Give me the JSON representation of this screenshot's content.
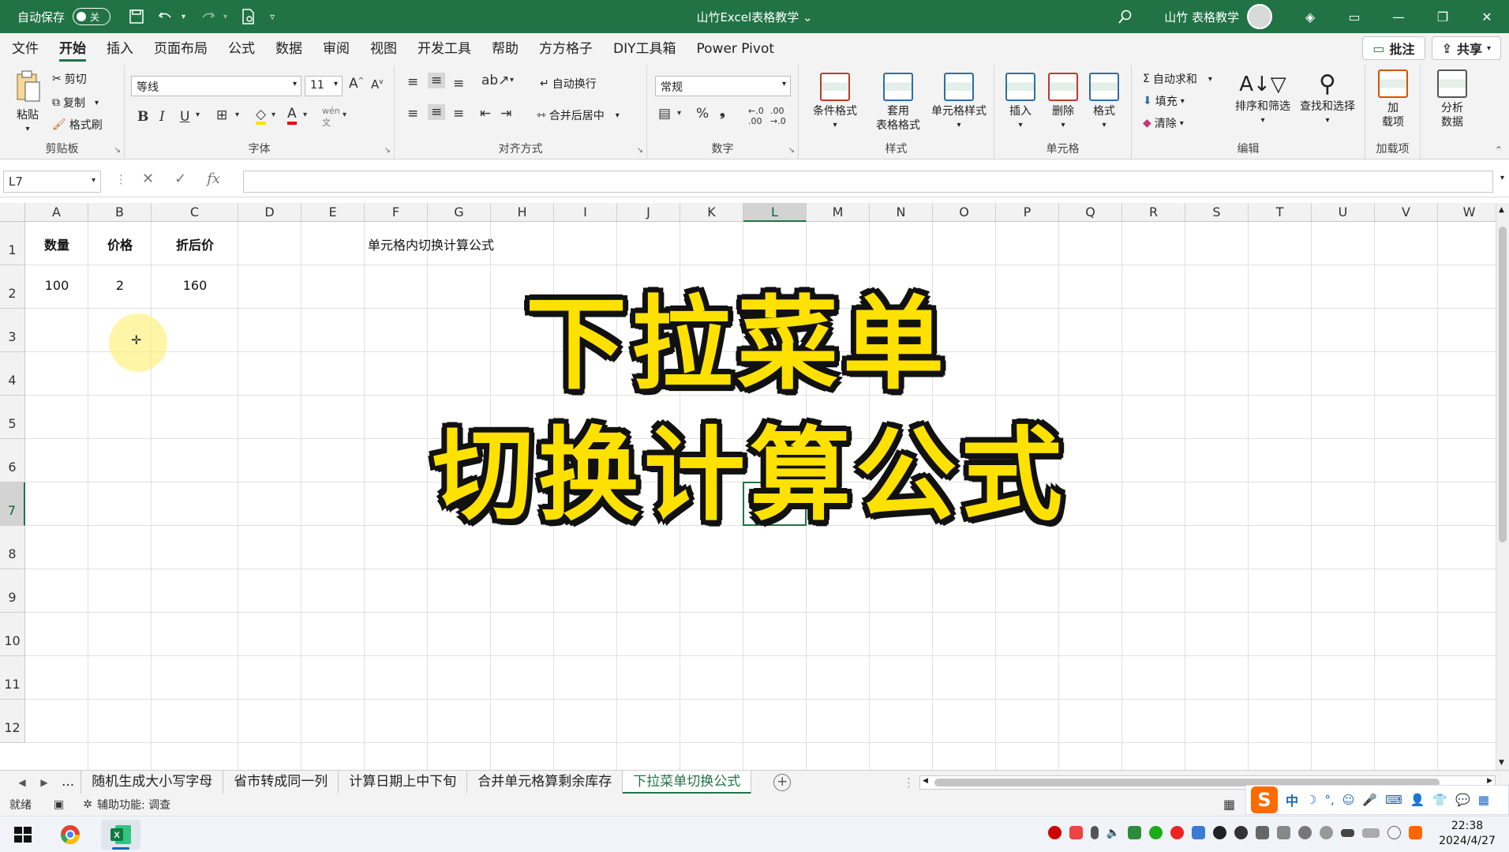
{
  "titlebar": {
    "autosave_label": "自动保存",
    "autosave_state": "关",
    "document_title": "山竹Excel表格教学 ⌄",
    "user_name": "山竹 表格教学"
  },
  "menu": {
    "tabs": [
      "文件",
      "开始",
      "插入",
      "页面布局",
      "公式",
      "数据",
      "审阅",
      "视图",
      "开发工具",
      "帮助",
      "方方格子",
      "DIY工具箱",
      "Power Pivot"
    ],
    "active_tab": "开始",
    "comment_btn": "批注",
    "share_btn": "共享"
  },
  "ribbon": {
    "clipboard": {
      "paste": "粘贴",
      "cut": "剪切",
      "copy": "复制",
      "format_painter": "格式刷",
      "label": "剪贴板"
    },
    "font": {
      "name": "等线",
      "size": "11",
      "label": "字体",
      "bold": "B",
      "italic": "I",
      "underline": "U"
    },
    "alignment": {
      "wrap": "自动换行",
      "merge": "合并后居中",
      "label": "对齐方式"
    },
    "number": {
      "format": "常规",
      "label": "数字",
      "percent": "%"
    },
    "styles": {
      "conditional": "条件格式",
      "table_line1": "套用",
      "table_line2": "表格格式",
      "cell_styles": "单元格样式",
      "label": "样式"
    },
    "cells": {
      "insert": "插入",
      "delete": "删除",
      "format": "格式",
      "label": "单元格"
    },
    "editing": {
      "autosum": "自动求和",
      "fill": "填充",
      "clear": "清除",
      "sort": "排序和筛选",
      "find": "查找和选择",
      "label": "编辑"
    },
    "addins": {
      "line1": "加",
      "line2": "载项",
      "label": "加载项"
    },
    "analyze": {
      "line1": "分析",
      "line2": "数据"
    }
  },
  "formula_bar": {
    "name_box": "L7",
    "fx": "fx",
    "content": ""
  },
  "grid": {
    "columns": [
      "A",
      "B",
      "C",
      "D",
      "E",
      "F",
      "G",
      "H",
      "I",
      "J",
      "K",
      "L",
      "M",
      "N",
      "O",
      "P",
      "Q",
      "R",
      "S",
      "T",
      "U",
      "V",
      "W"
    ],
    "rows": [
      "1",
      "2",
      "3",
      "4",
      "5",
      "6",
      "7",
      "8",
      "9",
      "10",
      "11",
      "12"
    ],
    "selected_cell": "L7",
    "cells": {
      "A1": "数量",
      "B1": "价格",
      "C1": "折后价",
      "A2": "100",
      "B2": "2",
      "C2": "160",
      "F1": "单元格内切换计算公式"
    }
  },
  "overlay": {
    "line1": "下拉菜单",
    "line2": "切换计算公式"
  },
  "sheets": {
    "tabs": [
      "随机生成大小写字母",
      "省市转成同一列",
      "计算日期上中下旬",
      "合并单元格算剩余库存",
      "下拉菜单切换公式"
    ],
    "active": "下拉菜单切换公式",
    "ellipsis": "..."
  },
  "status": {
    "ready": "就绪",
    "accessibility": "辅助功能: 调查"
  },
  "taskbar": {
    "time": "22:38",
    "date": "2024/4/27",
    "ime": "中"
  },
  "colors": {
    "accent": "#217346",
    "overlay_fill": "#ffe100",
    "overlay_stroke": "#111111"
  }
}
